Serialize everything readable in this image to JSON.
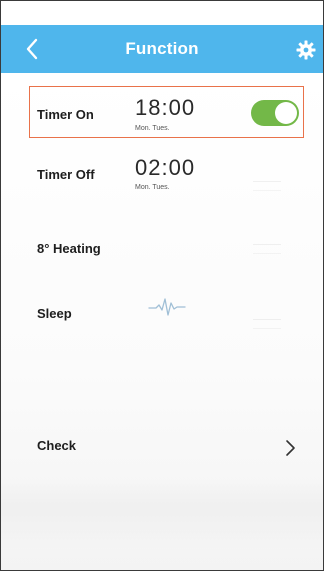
{
  "header": {
    "title": "Function",
    "color": "#4fb6ec"
  },
  "rows": [
    {
      "label": "Timer On",
      "time": "18:00",
      "days": "Mon. Tues.",
      "toggle_on": true
    },
    {
      "label": "Timer Off",
      "time": "02:00",
      "days": "Mon. Tues."
    },
    {
      "label": "8° Heating"
    },
    {
      "label": "Sleep",
      "icon": "sleep-wave-icon"
    },
    {
      "label": "Check",
      "icon": "chevron-right-icon"
    }
  ],
  "colors": {
    "highlight": "#e9724a",
    "toggle_on": "#73b848"
  }
}
